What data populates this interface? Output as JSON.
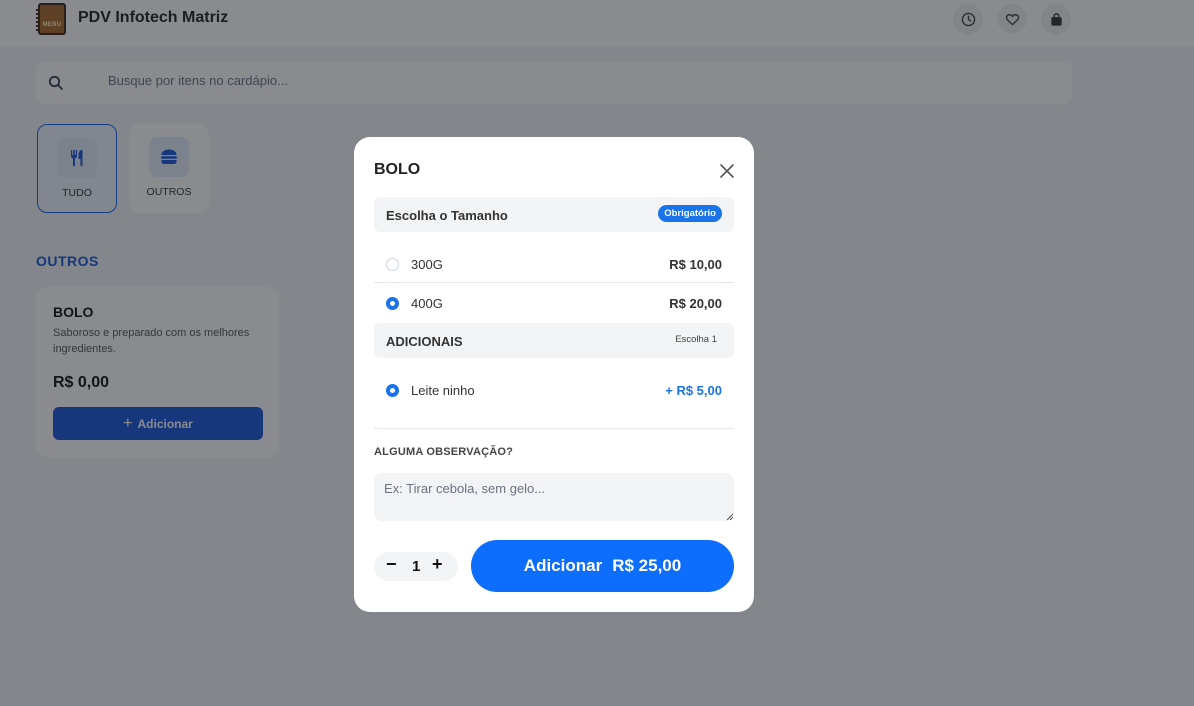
{
  "header": {
    "logo_text": "MENU",
    "title": "PDV Infotech Matriz",
    "icons": [
      "clock-icon",
      "heart-icon",
      "bag-icon"
    ]
  },
  "search": {
    "placeholder": "Busque por itens no cardápio...",
    "icon": "search-icon"
  },
  "categories": [
    {
      "label": "TUDO",
      "icon": "utensils-icon",
      "active": true
    },
    {
      "label": "OUTROS",
      "icon": "burger-icon",
      "active": false
    }
  ],
  "section": {
    "title": "OUTROS"
  },
  "product": {
    "name": "BOLO",
    "description": "Saboroso e preparado com os melhores ingredientes.",
    "price": "R$ 0,00",
    "add_label": "Adicionar"
  },
  "modal": {
    "title": "BOLO",
    "size_group": {
      "title": "Escolha o Tamanho",
      "badge": "Obrigatório",
      "options": [
        {
          "label": "300G",
          "price": "R$ 10,00",
          "selected": false
        },
        {
          "label": "400G",
          "price": "R$ 20,00",
          "selected": true
        }
      ]
    },
    "extras_group": {
      "title": "ADICIONAIS",
      "note": "Escolha 1",
      "options": [
        {
          "label": "Leite ninho",
          "price": "+ R$ 5,00",
          "selected": true
        }
      ]
    },
    "observation": {
      "label": "ALGUMA OBSERVAÇÃO?",
      "placeholder": "Ex: Tirar cebola, sem gelo...",
      "value": ""
    },
    "quantity": {
      "minus": "−",
      "value": "1",
      "plus": "+"
    },
    "add_button": {
      "label": "Adicionar",
      "total": "R$ 25,00"
    }
  },
  "colors": {
    "primary": "#1a56db",
    "accent": "#0d6efd",
    "overlay": "rgba(20,24,32,0.5)"
  }
}
